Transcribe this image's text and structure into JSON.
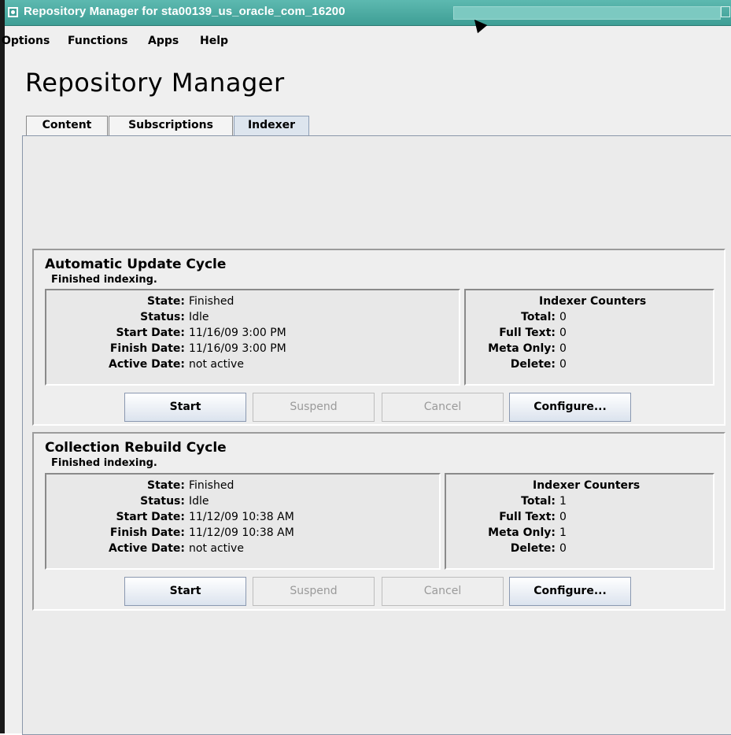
{
  "window": {
    "title": "Repository Manager for sta00139_us_oracle_com_16200"
  },
  "menu": [
    "Options",
    "Functions",
    "Apps",
    "Help"
  ],
  "page_title": "Repository Manager",
  "tabs": [
    {
      "label": "Content",
      "active": false
    },
    {
      "label": "Subscriptions",
      "active": false
    },
    {
      "label": "Indexer",
      "active": true
    }
  ],
  "cycles": [
    {
      "title": "Automatic Update Cycle",
      "subtitle": "Finished indexing.",
      "fields": [
        {
          "label": "State:",
          "value": "Finished"
        },
        {
          "label": "Status:",
          "value": "Idle"
        },
        {
          "label": "Start Date:",
          "value": "11/16/09 3:00 PM"
        },
        {
          "label": "Finish Date:",
          "value": "11/16/09 3:00 PM"
        },
        {
          "label": "Active Date:",
          "value": "not active"
        }
      ],
      "counters_title": "Indexer Counters",
      "counters": [
        {
          "label": "Total:",
          "value": "0"
        },
        {
          "label": "Full Text:",
          "value": "0"
        },
        {
          "label": "Meta Only:",
          "value": "0"
        },
        {
          "label": "Delete:",
          "value": "0"
        }
      ],
      "buttons": [
        {
          "label": "Start",
          "enabled": true
        },
        {
          "label": "Suspend",
          "enabled": false
        },
        {
          "label": "Cancel",
          "enabled": false
        },
        {
          "label": "Configure...",
          "enabled": true
        }
      ]
    },
    {
      "title": "Collection Rebuild Cycle",
      "subtitle": "Finished indexing.",
      "fields": [
        {
          "label": "State:",
          "value": "Finished"
        },
        {
          "label": "Status:",
          "value": "Idle"
        },
        {
          "label": "Start Date:",
          "value": "11/12/09 10:38 AM"
        },
        {
          "label": "Finish Date:",
          "value": "11/12/09 10:38 AM"
        },
        {
          "label": "Active Date:",
          "value": "not active"
        }
      ],
      "counters_title": "Indexer Counters",
      "counters": [
        {
          "label": "Total:",
          "value": "1"
        },
        {
          "label": "Full Text:",
          "value": "0"
        },
        {
          "label": "Meta Only:",
          "value": "1"
        },
        {
          "label": "Delete:",
          "value": "0"
        }
      ],
      "buttons": [
        {
          "label": "Start",
          "enabled": true
        },
        {
          "label": "Suspend",
          "enabled": false
        },
        {
          "label": "Cancel",
          "enabled": false
        },
        {
          "label": "Configure...",
          "enabled": true
        }
      ]
    }
  ],
  "colors": {
    "titlebar": "#3e9e95",
    "active_tab": "#dde5ee"
  }
}
